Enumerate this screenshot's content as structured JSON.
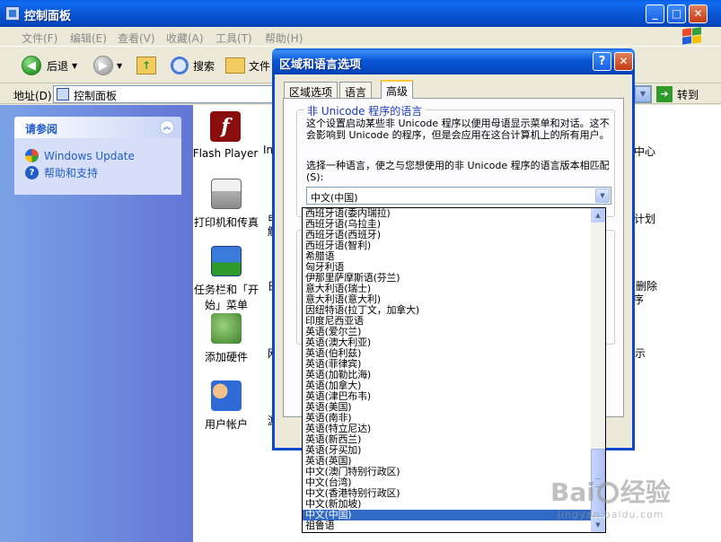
{
  "window": {
    "title": "控制面板",
    "minimize": "_",
    "maximize": "□",
    "close": "✕"
  },
  "menu": [
    "文件(F)",
    "编辑(E)",
    "查看(V)",
    "收藏(A)",
    "工具(T)",
    "帮助(H)"
  ],
  "toolbar": {
    "back": "后退",
    "search": "搜索",
    "folders": "文件"
  },
  "address": {
    "label": "地址(D)",
    "value": "控制面板",
    "go": "转到"
  },
  "see_also": {
    "title": "请参阅",
    "links": [
      "Windows Update",
      "帮助和支持"
    ]
  },
  "items": {
    "flash": "Flash Player",
    "flash_letter": "f",
    "printers": "打印机和传真",
    "taskbar": "任务栏和「开始」菜单",
    "hardware": "添加硬件",
    "users": "用户帐户",
    "cut_col2": [
      "In",
      "电",
      "解",
      "日",
      "网",
      "游"
    ],
    "cut_right": [
      "中心",
      "计划",
      "删除",
      "序",
      "示"
    ]
  },
  "dialog": {
    "title": "区域和语言选项",
    "help": "?",
    "close": "✕",
    "tabs": [
      "区域选项",
      "语言",
      "高级"
    ],
    "group_label": "非 Unicode 程序的语言",
    "description": "这个设置启动某些非 Unicode 程序以便用母语显示菜单和对话。这不会影响到 Unicode 的程序，但是会应用在这台计算机上的所有用户。",
    "choose": "选择一种语言，使之与您想使用的非 Unicode 程序的语言版本相匹配(S):",
    "selected": "中文(中国)",
    "group2_bit": "代"
  },
  "dropdown": {
    "options": [
      "西班牙语(委内瑞拉)",
      "西班牙语(乌拉圭)",
      "西班牙语(西班牙)",
      "西班牙语(智利)",
      "希腊语",
      "匈牙利语",
      "伊那里萨摩斯语(芬兰)",
      "意大利语(瑞士)",
      "意大利语(意大利)",
      "因纽特语(拉丁文，加拿大)",
      "印度尼西亚语",
      "英语(爱尔兰)",
      "英语(澳大利亚)",
      "英语(伯利兹)",
      "英语(菲律宾)",
      "英语(加勒比海)",
      "英语(加拿大)",
      "英语(津巴布韦)",
      "英语(美国)",
      "英语(南非)",
      "英语(特立尼达)",
      "英语(新西兰)",
      "英语(牙买加)",
      "英语(英国)",
      "中文(澳门特别行政区)",
      "中文(台湾)",
      "中文(香港特别行政区)",
      "中文(新加坡)",
      "中文(中国)",
      "祖鲁语"
    ],
    "selected_index": 28
  },
  "watermark": {
    "brand": "Bai",
    "brand2": "经验",
    "url": "jingyan.baidu.com"
  }
}
